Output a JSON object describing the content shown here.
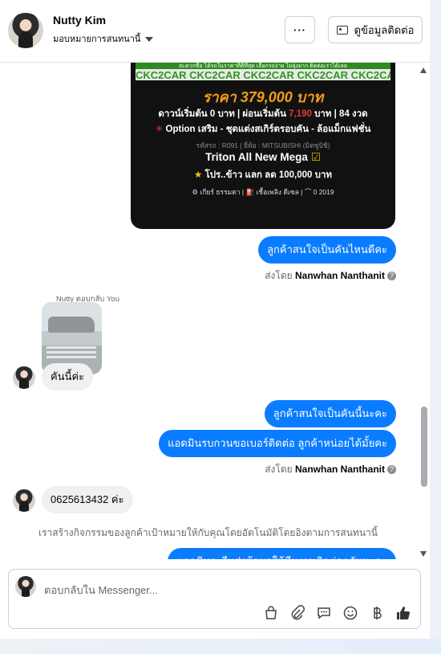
{
  "header": {
    "name": "Nutty Kim",
    "assign_label": "มอบหมายการสนทนานี้",
    "more_label": "···",
    "contact_label": "ดูข้อมูลติดต่อ"
  },
  "car_ad": {
    "banner_top": "สะดวกซื้อ ได้รถในราคาที่ดีที่สุด เลือกรถง่าย ไม่ยุ่งยาก ติดต่อเราได้เลย",
    "brand_strip": "CKC2CAR CKC2CAR CKC2CAR CKC2CAR CKC2CAR CKC2CAR",
    "price": "ราคา 379,000 บาท",
    "down_a": "ดาวน์เริ่มต้น 0 บาท | ผ่อนเริ่มต้น ",
    "down_red": "7,190",
    "down_b": " บาท | 84 งวด",
    "option_star": "✳",
    "option": "Option เสริม - ชุดแต่งสเกิร์ตรอบคัน - ล้อแม็กแฟชั่น",
    "code": "รหัสรถ : R091 | ยี่ห้อ : MITSUBISHI (มิตซูบิชิ)",
    "model": "Triton All New Mega",
    "model_check": "☑",
    "promo_star": "★",
    "promo": "โปร..ข้าว แลก ลด 100,000 บาท",
    "specs": "⚙ เกียร์ ธรรมดา  |  ⛽ เชื้อเพลิง ดีเซล  |  ⌒ 0 2019"
  },
  "messages": {
    "out1": "ลูกค้าสนใจเป็นคันไหนดีคะ",
    "sent_by_prefix": "ส่งโดย",
    "sender": "Nanwhan Nanthanit",
    "reply_label": "Nutty ตอบกลับ You",
    "in1": "คันนี้ค่ะ",
    "out2": "ลูกค้าสนใจเป็นคันนี้นะคะ",
    "out3": "แอดมินรบกวนขอเบอร์ติดต่อ ลูกค้าหน่อยได้มั้ยคะ",
    "in2": "0625613432 ค่ะ",
    "auto_note": "เราสร้างกิจกรรมของลูกค้าเป้าหมายให้กับคุณโดยอัตโนมัติโดยอิงตามการสนทนานี้",
    "out4_partial": "แอดมินจะรีบส่งข้อมูลให้ทีมงานติดต่อกลับนะคะ"
  },
  "composer": {
    "placeholder": "ตอบกลับใน Messenger..."
  },
  "icons": [
    "gift-bag-icon",
    "paperclip-icon",
    "saved-reply-icon",
    "emoji-icon",
    "baht-icon",
    "thumbs-up-icon"
  ],
  "colors": {
    "accent": "#0a7cff",
    "price_orange": "#f39c12",
    "red": "#e53935"
  }
}
